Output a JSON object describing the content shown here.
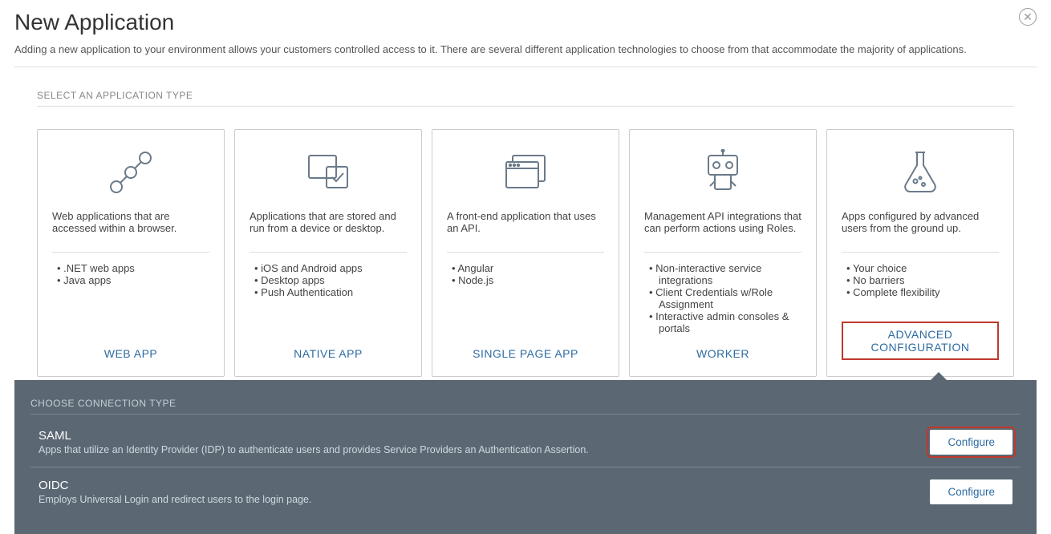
{
  "header": {
    "title": "New Application",
    "subtitle": "Adding a new application to your environment allows your customers controlled access to it. There are several different application technologies to choose from that accommodate the majority of applications."
  },
  "section_label": "SELECT AN APPLICATION TYPE",
  "cards": [
    {
      "icon": "nodes-icon",
      "description": "Web applications that are accessed within a browser.",
      "bullets": [
        ".NET web apps",
        "Java apps"
      ],
      "title": "WEB APP"
    },
    {
      "icon": "device-check-icon",
      "description": "Applications that are stored and run from a device or desktop.",
      "bullets": [
        "iOS and Android apps",
        "Desktop apps",
        "Push Authentication"
      ],
      "title": "NATIVE APP"
    },
    {
      "icon": "browser-windows-icon",
      "description": "A front-end application that uses an API.",
      "bullets": [
        "Angular",
        "Node.js"
      ],
      "title": "SINGLE PAGE APP"
    },
    {
      "icon": "robot-icon",
      "description": "Management API integrations that can perform actions using Roles.",
      "bullets": [
        "Non-interactive service integrations",
        "Client Credentials w/Role Assignment",
        "Interactive admin consoles & portals"
      ],
      "title": "WORKER"
    },
    {
      "icon": "flask-icon",
      "description": "Apps configured by advanced users from the ground up.",
      "bullets": [
        "Your choice",
        "No barriers",
        "Complete flexibility"
      ],
      "title": "ADVANCED CONFIGURATION",
      "selected": true
    }
  ],
  "panel": {
    "label": "CHOOSE CONNECTION TYPE",
    "rows": [
      {
        "title": "SAML",
        "description": "Apps that utilize an Identity Provider (IDP) to authenticate users and provides Service Providers an Authentication Assertion.",
        "button": "Configure",
        "highlight": true
      },
      {
        "title": "OIDC",
        "description": "Employs Universal Login and redirect users to the login page.",
        "button": "Configure",
        "highlight": false
      }
    ]
  }
}
